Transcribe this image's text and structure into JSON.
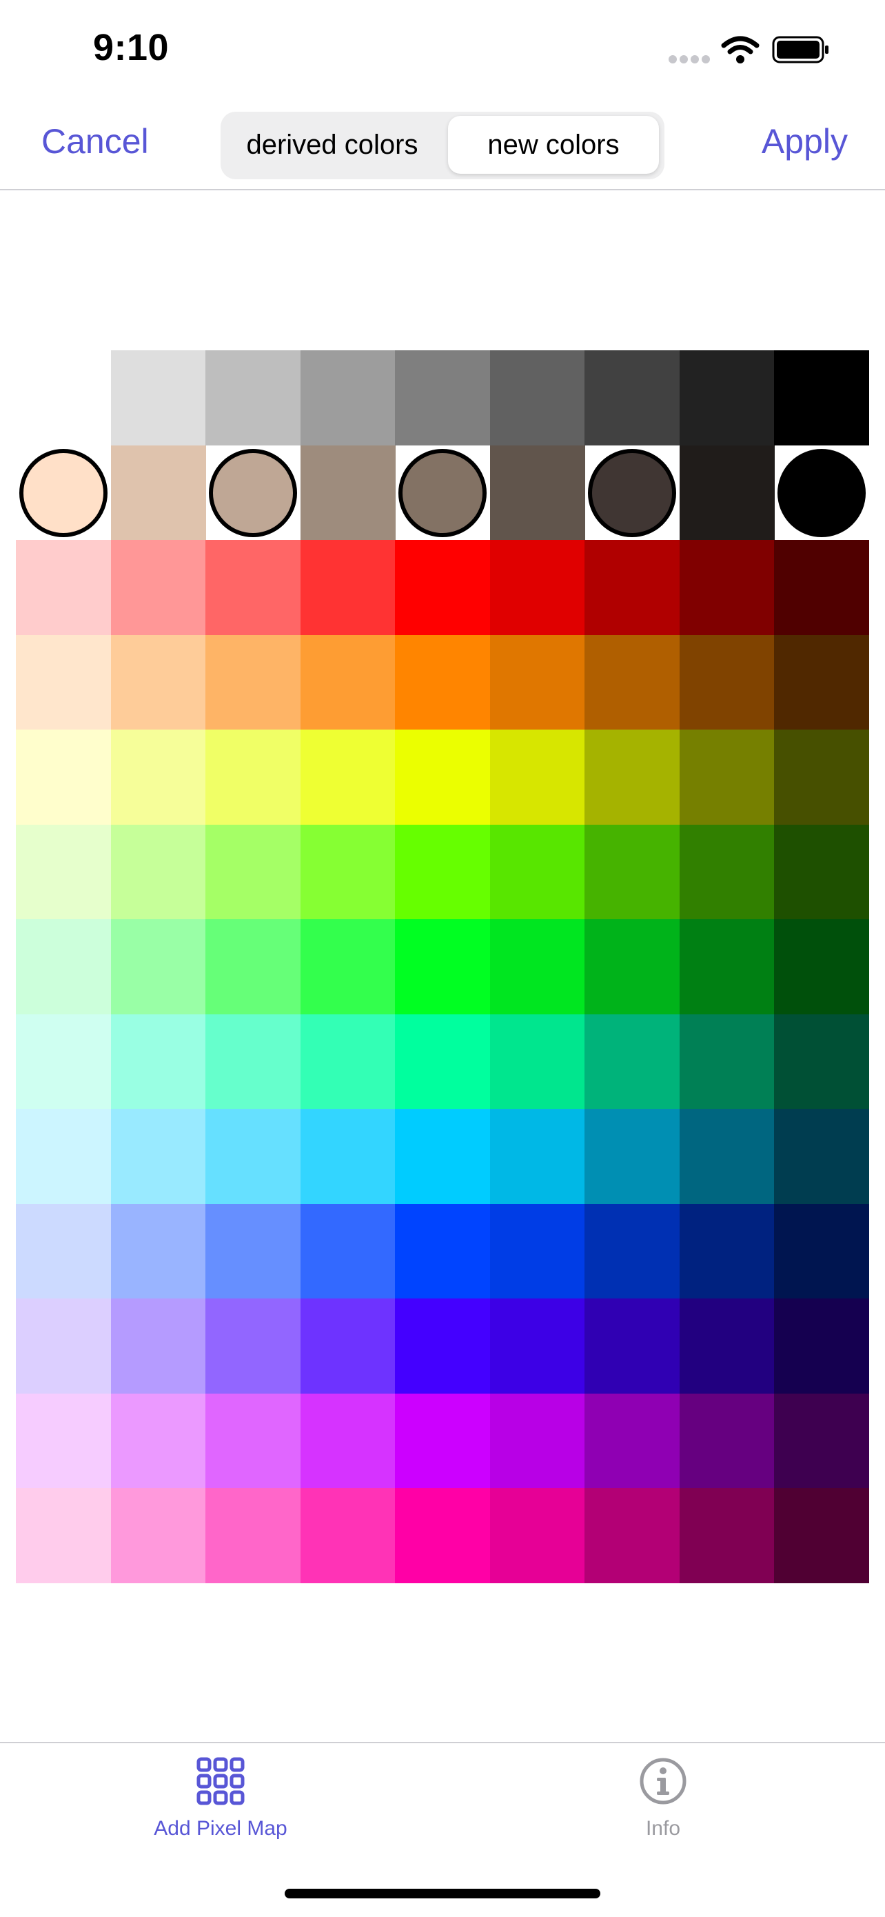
{
  "status_bar": {
    "time": "9:10"
  },
  "nav": {
    "cancel_label": "Cancel",
    "apply_label": "Apply",
    "segments": [
      {
        "label": "derived colors",
        "selected": false
      },
      {
        "label": "new colors",
        "selected": true
      }
    ]
  },
  "palette": {
    "rows": [
      [
        "",
        "#dedede",
        "#bebebe",
        "#9d9d9d",
        "#7f7f7f",
        "#616161",
        "#414141",
        "#222222",
        "#000000"
      ],
      [
        "#ffe0c8",
        "#dfc3ad",
        "#bfa795",
        "#9e8c7d",
        "#837264",
        "#61554c",
        "#403633",
        "#201c1a",
        "#000000"
      ],
      [
        "#ffcccc",
        "#ff9797",
        "#ff6666",
        "#ff3333",
        "#ff0000",
        "#e00000",
        "#b00000",
        "#800000",
        "#500000"
      ],
      [
        "#ffe6cc",
        "#fecc99",
        "#feb466",
        "#fe9d33",
        "#ff8500",
        "#e07700",
        "#b05f00",
        "#804300",
        "#502800"
      ],
      [
        "#fffecc",
        "#f6fe99",
        "#f0ff66",
        "#eeff33",
        "#ebff00",
        "#d7e600",
        "#a5b300",
        "#768000",
        "#475000"
      ],
      [
        "#e6ffcc",
        "#c6ff99",
        "#a5ff66",
        "#86ff33",
        "#66ff00",
        "#58e600",
        "#46b300",
        "#318000",
        "#1e5000"
      ],
      [
        "#ccffdb",
        "#99ffa6",
        "#66ff78",
        "#33ff4d",
        "#00ff22",
        "#00e620",
        "#00b31a",
        "#008013",
        "#00500b"
      ],
      [
        "#cffff1",
        "#99ffe3",
        "#66ffcc",
        "#33ffb5",
        "#00ff9e",
        "#00e68e",
        "#00b37a",
        "#008055",
        "#005035"
      ],
      [
        "#ccf5ff",
        "#99eaff",
        "#66e0ff",
        "#33d5ff",
        "#00ccff",
        "#00b8e6",
        "#008fb3",
        "#006680",
        "#003d50"
      ],
      [
        "#ccdaff",
        "#99b4ff",
        "#668fff",
        "#3369ff",
        "#0044ff",
        "#003de6",
        "#0030b3",
        "#002280",
        "#001550"
      ],
      [
        "#dccfff",
        "#b59bff",
        "#9266ff",
        "#6e33ff",
        "#4400ff",
        "#3d00e6",
        "#3000b3",
        "#220080",
        "#150050"
      ],
      [
        "#f6ccff",
        "#eb99ff",
        "#e066ff",
        "#d633ff",
        "#cc00ff",
        "#b800e6",
        "#8f00b3",
        "#660080",
        "#3e0050"
      ],
      [
        "#ffccec",
        "#ff99dc",
        "#ff66c9",
        "#ff33b6",
        "#ff00a6",
        "#e60096",
        "#b30075",
        "#800053",
        "#500033"
      ]
    ],
    "selected_swatches": [
      [
        1,
        0
      ],
      [
        1,
        2
      ],
      [
        1,
        4
      ],
      [
        1,
        6
      ],
      [
        1,
        8
      ]
    ]
  },
  "tab_bar": {
    "items": [
      {
        "label": "Add Pixel Map",
        "icon": "grid-icon",
        "active": true
      },
      {
        "label": "Info",
        "icon": "info-icon",
        "active": false
      }
    ]
  },
  "colors": {
    "accent": "#5856d6",
    "inactive": "#9a9a9f"
  }
}
